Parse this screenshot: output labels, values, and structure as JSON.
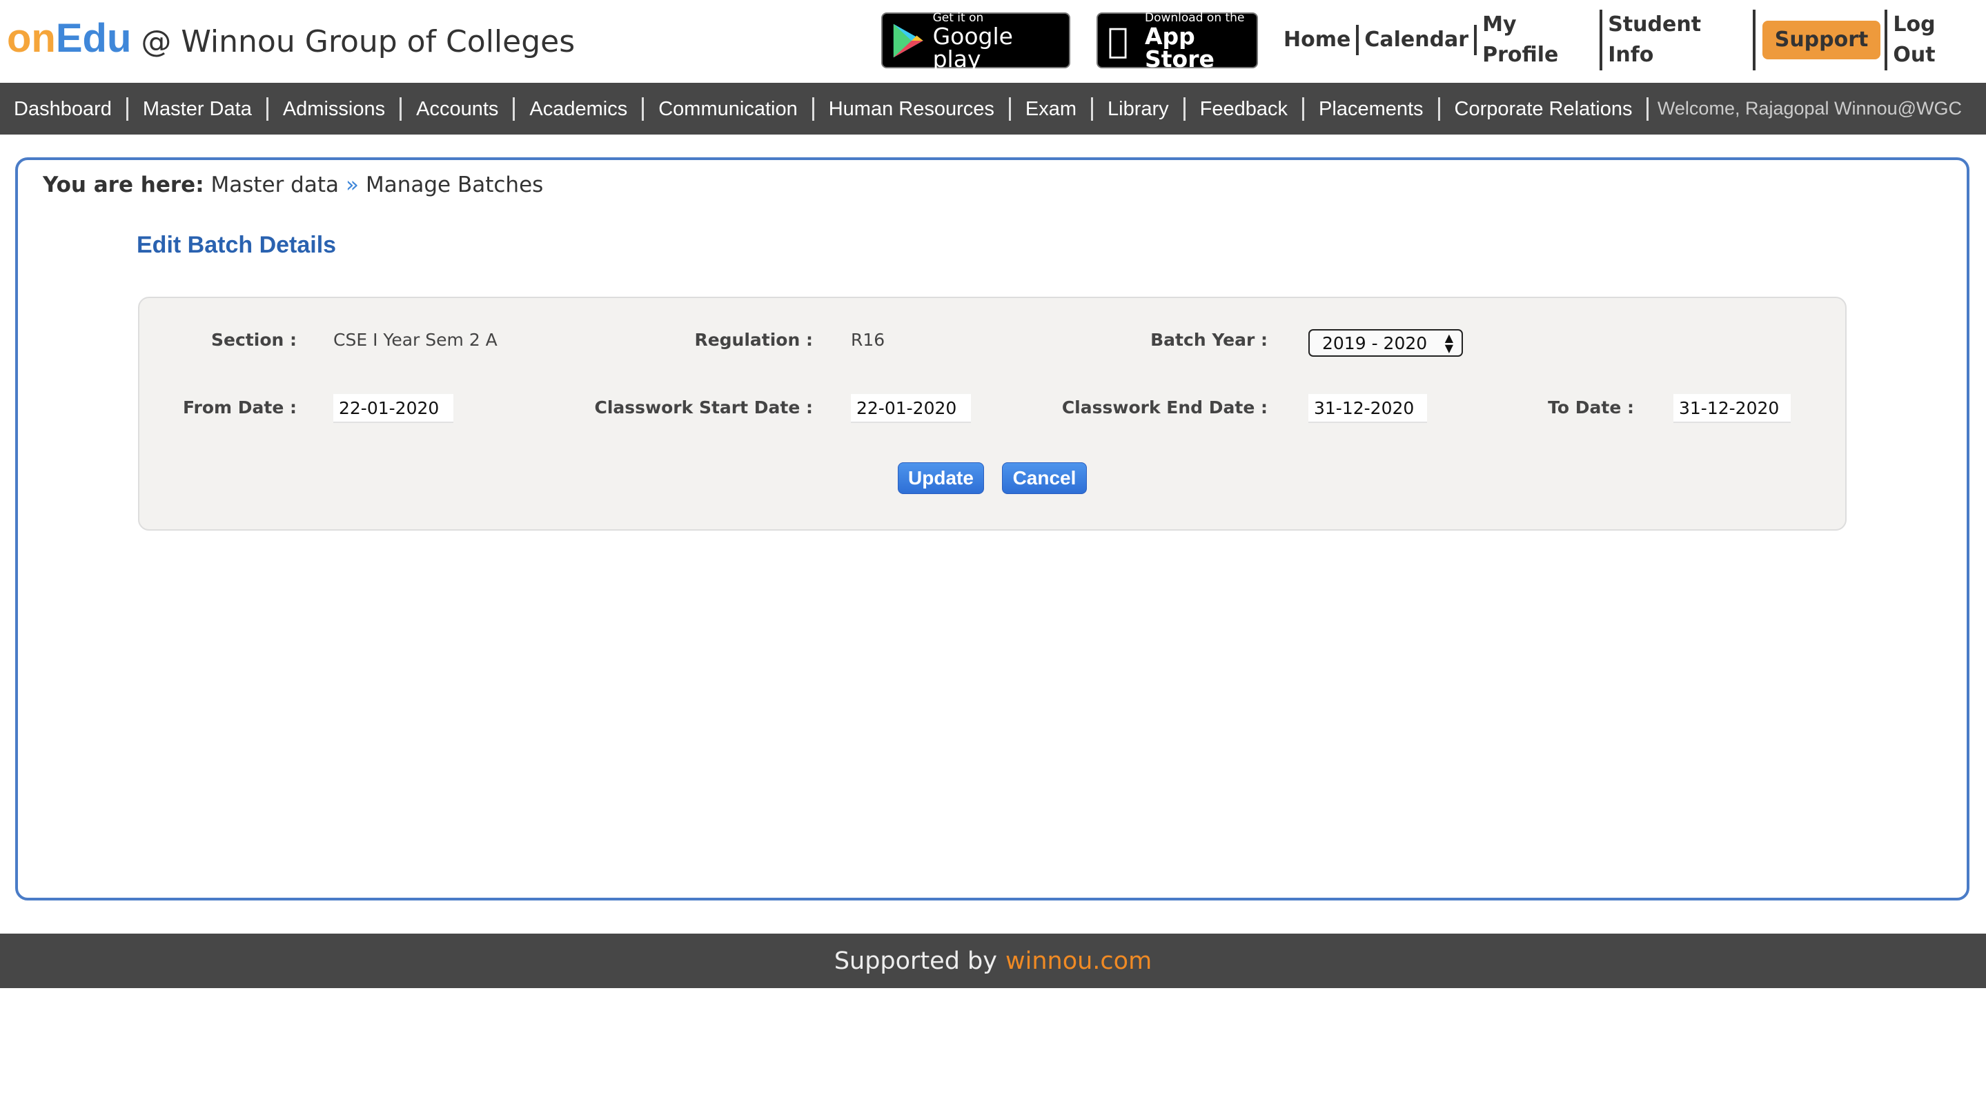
{
  "header": {
    "logo_on": "onEdu",
    "logo_on_part": "on",
    "logo_edu_part": "Edu",
    "org": "@ Winnou Group of Colleges",
    "google_play": {
      "small": "Get it on",
      "big": "Google play"
    },
    "app_store": {
      "small": "Download on the",
      "big": "App Store"
    },
    "links": [
      "Home",
      "Calendar",
      "My Profile",
      "Student Info",
      "Support",
      "Log Out"
    ]
  },
  "nav": {
    "items": [
      "Dashboard",
      "Master Data",
      "Admissions",
      "Accounts",
      "Academics",
      "Communication",
      "Human Resources",
      "Exam",
      "Library",
      "Feedback",
      "Placements",
      "Corporate Relations"
    ],
    "welcome": "Welcome, Rajagopal Winnou@WGC"
  },
  "breadcrumb": {
    "prefix": "You are here:",
    "items": [
      "Master data",
      "Manage Batches"
    ],
    "separator": "»"
  },
  "page_title": "Edit Batch Details",
  "form": {
    "section_label": "Section :",
    "section_value": "CSE I Year Sem 2 A",
    "regulation_label": "Regulation :",
    "regulation_value": "R16",
    "batch_year_label": "Batch Year :",
    "batch_year_value": "2019 - 2020",
    "from_date_label": "From Date :",
    "from_date_value": "22-01-2020",
    "cw_start_label": "Classwork Start Date :",
    "cw_start_value": "22-01-2020",
    "cw_end_label": "Classwork End Date :",
    "cw_end_value": "31-12-2020",
    "to_date_label": "To Date :",
    "to_date_value": "31-12-2020",
    "update": "Update",
    "cancel": "Cancel"
  },
  "footer": {
    "text": "Supported by",
    "link": "winnou.com"
  },
  "colors": {
    "brand_orange": "#f5a53a",
    "brand_blue": "#3f87d9",
    "nav_bg": "#474747",
    "support_bg": "#ee9a3c",
    "button_blue": "#2e6fd6"
  }
}
